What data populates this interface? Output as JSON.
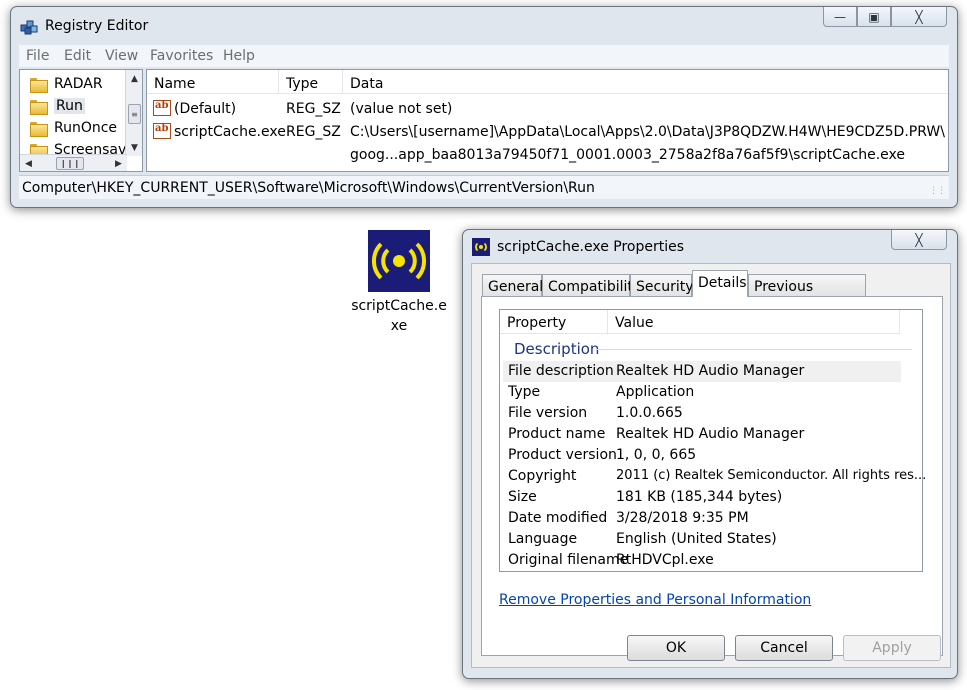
{
  "registry_editor": {
    "title": "Registry Editor",
    "caption_buttons": {
      "minimize": "—",
      "maximize": "▣",
      "close": "╳"
    },
    "menu": [
      "File",
      "Edit",
      "View",
      "Favorites",
      "Help"
    ],
    "tree_items": [
      "RADAR",
      "Run",
      "RunOnce",
      "Screensav"
    ],
    "selected_tree_item": "Run",
    "columns": [
      "Name",
      "Type",
      "Data"
    ],
    "values": [
      {
        "name": "(Default)",
        "type": "REG_SZ",
        "data": "(value not set)",
        "icon": "string-value-icon"
      },
      {
        "name": "scriptCache.exe",
        "type": "REG_SZ",
        "data": "C:\\Users\\[username]\\AppData\\Local\\Apps\\2.0\\Data\\J3P8QDZW.H4W\\HE9CDZ5D.PRW\\",
        "data_line2": "goog...app_baa8013a79450f71_0001.0003_2758a2f8a76af5f9\\scriptCache.exe",
        "icon": "string-value-icon"
      }
    ],
    "status_path": "Computer\\HKEY_CURRENT_USER\\Software\\Microsoft\\Windows\\CurrentVersion\\Run",
    "string_icon_text": "ab"
  },
  "desktop_icon": {
    "label": "scriptCache.exe",
    "icon": "audio-broadcast-icon",
    "icon_bg": "#1a1c78",
    "icon_fg": "#f5e300"
  },
  "properties_dialog": {
    "title": "scriptCache.exe Properties",
    "close_label": "╳",
    "tabs": [
      "General",
      "Compatibility",
      "Security",
      "Details",
      "Previous Versions"
    ],
    "active_tab": "Details",
    "columns": [
      "Property",
      "Value"
    ],
    "section": "Description",
    "properties": [
      {
        "key": "File description",
        "value": "Realtek HD Audio Manager",
        "selected": true
      },
      {
        "key": "Type",
        "value": "Application"
      },
      {
        "key": "File version",
        "value": "1.0.0.665"
      },
      {
        "key": "Product name",
        "value": "Realtek HD Audio Manager"
      },
      {
        "key": "Product version",
        "value": "1, 0, 0, 665"
      },
      {
        "key": "Copyright",
        "value": "2011 (c) Realtek Semiconductor.  All rights res..."
      },
      {
        "key": "Size",
        "value": "181 KB (185,344 bytes)"
      },
      {
        "key": "Date modified",
        "value": "3/28/2018 9:35 PM"
      },
      {
        "key": "Language",
        "value": "English (United States)"
      },
      {
        "key": "Original filename",
        "value": "RtHDVCpl.exe"
      }
    ],
    "remove_link": "Remove Properties and Personal Information",
    "buttons": {
      "ok": "OK",
      "cancel": "Cancel",
      "apply": "Apply"
    }
  }
}
